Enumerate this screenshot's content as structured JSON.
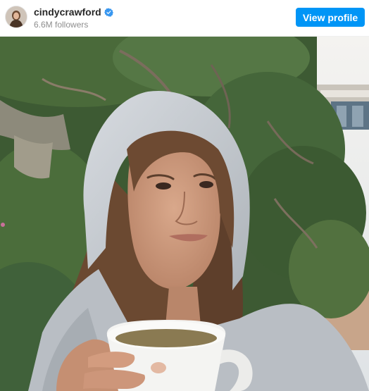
{
  "post": {
    "username": "cindycrawford",
    "followers": "6.6M followers",
    "view_profile_label": "View profile",
    "verified": true
  },
  "colors": {
    "accent": "#0095f6",
    "verified_badge": "#3897f0",
    "username_text": "#262626",
    "secondary_text": "#8e8e8e"
  },
  "icons": {
    "verified": "verified-badge-icon"
  }
}
